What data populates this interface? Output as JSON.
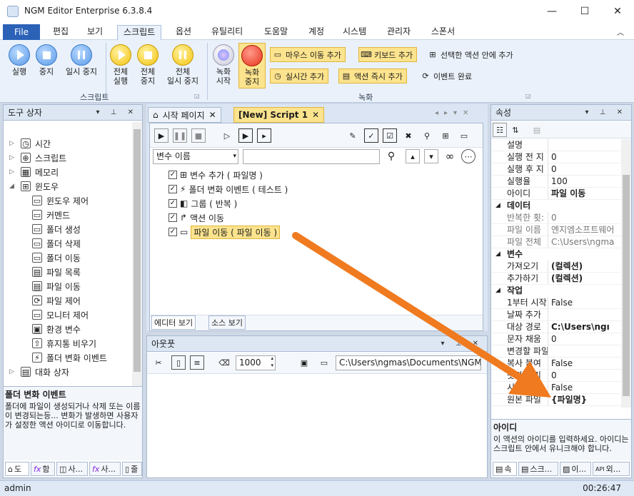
{
  "window": {
    "title": "NGM Editor   Enterprise 6.3.8.4",
    "minimize": "—",
    "maximize": "☐",
    "close": "✕"
  },
  "menu": {
    "file": "File",
    "items": [
      "편집",
      "보기",
      "스크립트",
      "옵션",
      "유틸리티",
      "도움말",
      "계정",
      "시스템",
      "관리자",
      "스폰서"
    ],
    "active_index": 2
  },
  "ribbon": {
    "script_group": {
      "label": "스크립트",
      "buttons": [
        "실행",
        "중지",
        "일시 중지",
        "전체\n실행",
        "전체\n중지",
        "전체\n일시 중지"
      ]
    },
    "record_group": {
      "label": "녹화",
      "record_start": "녹화\n시작",
      "record_stop": "녹화\n중지",
      "small_buttons": [
        "마우스 이동 추가",
        "키보드 추가",
        "선택한 액션 안에 추가",
        "실시간 추가",
        "액션 즉시 추가",
        "이벤트 완료"
      ]
    }
  },
  "toolbox": {
    "title": "도구 상자",
    "items": [
      {
        "label": "시간",
        "level": 0,
        "expand": "▷"
      },
      {
        "label": "스크립트",
        "level": 0,
        "expand": "▷"
      },
      {
        "label": "메모리",
        "level": 0,
        "expand": "▷"
      },
      {
        "label": "윈도우",
        "level": 0,
        "expand": "◢"
      },
      {
        "label": "윈도우 제어",
        "level": 1
      },
      {
        "label": "커멘드",
        "level": 1
      },
      {
        "label": "폴더 생성",
        "level": 1
      },
      {
        "label": "폴더 삭제",
        "level": 1
      },
      {
        "label": "폴더 이동",
        "level": 1
      },
      {
        "label": "파일 목록",
        "level": 1
      },
      {
        "label": "파일 이동",
        "level": 1
      },
      {
        "label": "파일 제어",
        "level": 1
      },
      {
        "label": "모니터 제어",
        "level": 1
      },
      {
        "label": "환경 변수",
        "level": 1
      },
      {
        "label": "휴지통 비우기",
        "level": 1
      },
      {
        "label": "폴더 변화 이벤트",
        "level": 1
      },
      {
        "label": "대화 상자",
        "level": 0,
        "expand": "▷"
      }
    ],
    "desc_title": "폴더 변화 이벤트",
    "desc_text": "폴더에 파일이 생성되거나 삭제 또는 이름이 변경되는등... 변화가 발생하면 사용자가 설정한 액션 아이디로 이동합니다.",
    "bottom_tabs": [
      "도",
      "함",
      "사...",
      "사...",
      "줄"
    ]
  },
  "editor": {
    "tabs": [
      "시작 페이지",
      "[New] Script 1"
    ],
    "var_dropdown": "변수 이름",
    "script_items": [
      {
        "label": "변수 추가 ( 파일명 )",
        "checked": "✓"
      },
      {
        "label": "폴더 변화 이벤트 ( 테스트 )",
        "checked": "✓"
      },
      {
        "label": "그룹 ( 반복 )",
        "checked": "✓"
      },
      {
        "label": "액션 이동",
        "checked": "✓"
      },
      {
        "label": "파일 이동 ( 파일 이동 )",
        "checked": "✓"
      }
    ],
    "view_tabs": [
      "에디터 보기",
      "소스 보기"
    ]
  },
  "output": {
    "title": "아웃풋",
    "count": "1000",
    "path": "C:\\Users\\ngmas\\Documents\\NGM6\\"
  },
  "properties": {
    "title": "속성",
    "rows": [
      {
        "type": "row",
        "name": "설명",
        "value": ""
      },
      {
        "type": "row",
        "name": "실행 전 지",
        "value": "0"
      },
      {
        "type": "row",
        "name": "실행 후 지",
        "value": "0"
      },
      {
        "type": "row",
        "name": "실행율",
        "value": "100"
      },
      {
        "type": "row",
        "name": "아이디",
        "value": "파일 이동",
        "bold": true
      },
      {
        "type": "cat",
        "name": "데이터"
      },
      {
        "type": "row",
        "name": "반복한 횟:",
        "value": "0",
        "gray": true
      },
      {
        "type": "row",
        "name": "파일 이름",
        "value": "엔지엠소프트웨어",
        "gray": true
      },
      {
        "type": "row",
        "name": "파일 전체",
        "value": "C:\\Users\\ngma",
        "gray": true
      },
      {
        "type": "cat",
        "name": "변수"
      },
      {
        "type": "row",
        "name": "가져오기",
        "value": "(컬렉션)",
        "bold": true
      },
      {
        "type": "row",
        "name": "추가하기",
        "value": "(컬렉션)",
        "bold": true
      },
      {
        "type": "cat",
        "name": "작업"
      },
      {
        "type": "row",
        "name": "1부터 시작",
        "value": "False"
      },
      {
        "type": "row",
        "name": "날짜 추가",
        "value": ""
      },
      {
        "type": "row",
        "name": "대상 경로",
        "value": "C:\\Users\\ngı",
        "bold": true
      },
      {
        "type": "row",
        "name": "문자 채움",
        "value": "0"
      },
      {
        "type": "row",
        "name": "변경할 파일",
        "value": ""
      },
      {
        "type": "row",
        "name": "복사 붙여",
        "value": "False"
      },
      {
        "type": "row",
        "name": "숫자 자리",
        "value": "0"
      },
      {
        "type": "row",
        "name": "시간 추가",
        "value": "False"
      },
      {
        "type": "row",
        "name": "원본 파일",
        "value": "{파일명}",
        "bold": true
      }
    ],
    "desc_title": "아이디",
    "desc_text": "이 액션의 아이디를 입력하세요. 아이디는 스크립트 안에서 유니크해야 합니다.",
    "bottom_tabs": [
      "속",
      "스크...",
      "이...",
      "외..."
    ]
  },
  "status": {
    "user": "admin",
    "time": "00:26:47"
  },
  "colors": {
    "accent": "#2b62b8",
    "highlight": "#fce38d",
    "arrow": "#f07a1f"
  }
}
